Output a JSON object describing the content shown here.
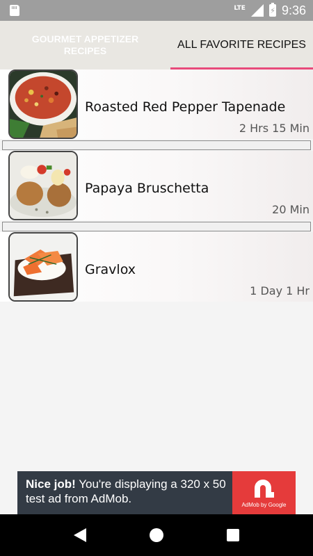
{
  "status_bar": {
    "time": "9:36",
    "network": "LTE",
    "icons": [
      "sd-card-icon",
      "signal-icon",
      "battery-charging-icon"
    ]
  },
  "tabs": [
    {
      "label": "GOURMET APPETIZER RECIPES",
      "active": false
    },
    {
      "label": "ALL FAVORITE RECIPES",
      "active": true
    }
  ],
  "colors": {
    "accent": "#e84a7a",
    "status_bar": "#9e9e9e",
    "tab_bar": "#e9e7e2",
    "ad_background": "#333b45",
    "ad_logo": "#e53b3b"
  },
  "recipes": [
    {
      "title": "Roasted Red Pepper Tapenade",
      "time": "2 Hrs 15 Min",
      "image": "tapenade-photo"
    },
    {
      "title": "Papaya Bruschetta",
      "time": "20 Min",
      "image": "bruschetta-photo"
    },
    {
      "title": "Gravlox",
      "time": "1 Day 1 Hr",
      "image": "gravlox-photo"
    }
  ],
  "ad": {
    "headline": "Nice job!",
    "body": " You're displaying a 320 x 50 test ad from AdMob.",
    "logo_caption": "AdMob by Google"
  },
  "nav_bar": {
    "icons": [
      "back-icon",
      "home-icon",
      "recents-icon"
    ]
  }
}
